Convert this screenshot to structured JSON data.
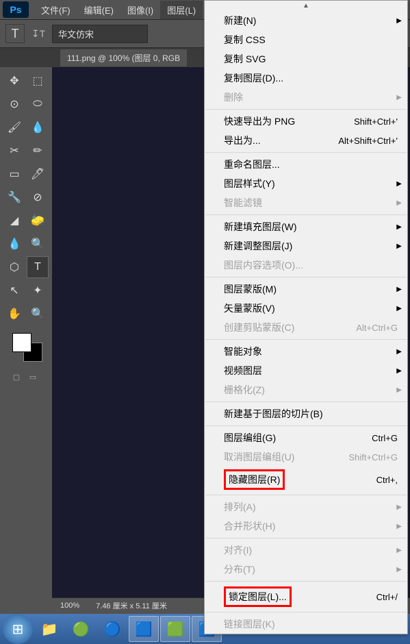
{
  "menubar": {
    "items": [
      "文件(F)",
      "编辑(E)",
      "图像(I)",
      "图层(L)"
    ]
  },
  "optionsbar": {
    "tool_icon": "T",
    "font_name": "华文仿宋"
  },
  "document": {
    "tab_label": "111.png @ 100% (图层 0, RGB"
  },
  "statusbar": {
    "zoom": "100%",
    "dimensions": "7.46 厘米 x 5.11 厘米"
  },
  "dropdown": {
    "groups": [
      [
        {
          "label": "新建(N)",
          "sub": true
        },
        {
          "label": "复制 CSS"
        },
        {
          "label": "复制 SVG"
        },
        {
          "label": "复制图层(D)..."
        },
        {
          "label": "删除",
          "disabled": true,
          "sub": true
        }
      ],
      [
        {
          "label": "快速导出为 PNG",
          "shortcut": "Shift+Ctrl+'"
        },
        {
          "label": "导出为...",
          "shortcut": "Alt+Shift+Ctrl+'"
        }
      ],
      [
        {
          "label": "重命名图层..."
        },
        {
          "label": "图层样式(Y)",
          "sub": true
        },
        {
          "label": "智能滤镜",
          "disabled": true,
          "sub": true
        }
      ],
      [
        {
          "label": "新建填充图层(W)",
          "sub": true
        },
        {
          "label": "新建调整图层(J)",
          "sub": true
        },
        {
          "label": "图层内容选项(O)...",
          "disabled": true
        }
      ],
      [
        {
          "label": "图层蒙版(M)",
          "sub": true
        },
        {
          "label": "矢量蒙版(V)",
          "sub": true
        },
        {
          "label": "创建剪贴蒙版(C)",
          "shortcut": "Alt+Ctrl+G",
          "disabled": true
        }
      ],
      [
        {
          "label": "智能对象",
          "sub": true
        },
        {
          "label": "视频图层",
          "sub": true
        },
        {
          "label": "栅格化(Z)",
          "disabled": true,
          "sub": true
        }
      ],
      [
        {
          "label": "新建基于图层的切片(B)"
        }
      ],
      [
        {
          "label": "图层编组(G)",
          "shortcut": "Ctrl+G"
        },
        {
          "label": "取消图层编组(U)",
          "shortcut": "Shift+Ctrl+G",
          "disabled": true
        },
        {
          "label": "隐藏图层(R)",
          "shortcut": "Ctrl+,",
          "highlight": true
        }
      ],
      [
        {
          "label": "排列(A)",
          "disabled": true,
          "sub": true
        },
        {
          "label": "合并形状(H)",
          "disabled": true,
          "sub": true
        }
      ],
      [
        {
          "label": "对齐(I)",
          "disabled": true,
          "sub": true
        },
        {
          "label": "分布(T)",
          "disabled": true,
          "sub": true
        }
      ],
      [
        {
          "label": "锁定图层(L)...",
          "shortcut": "Ctrl+/",
          "highlight": true
        }
      ],
      [
        {
          "label": "链接图层(K)",
          "disabled": true
        }
      ]
    ]
  },
  "tools": {
    "icons": [
      "✥",
      "⬚",
      "⊙",
      "⬭",
      "🖌",
      "💧",
      "✂",
      "✏",
      "▭",
      "🖊",
      "🔧",
      "⊘",
      "◢",
      "🧽",
      "💧",
      "🔍",
      "⬡",
      "T",
      "↖",
      "✦",
      "✋",
      "🔍"
    ]
  }
}
